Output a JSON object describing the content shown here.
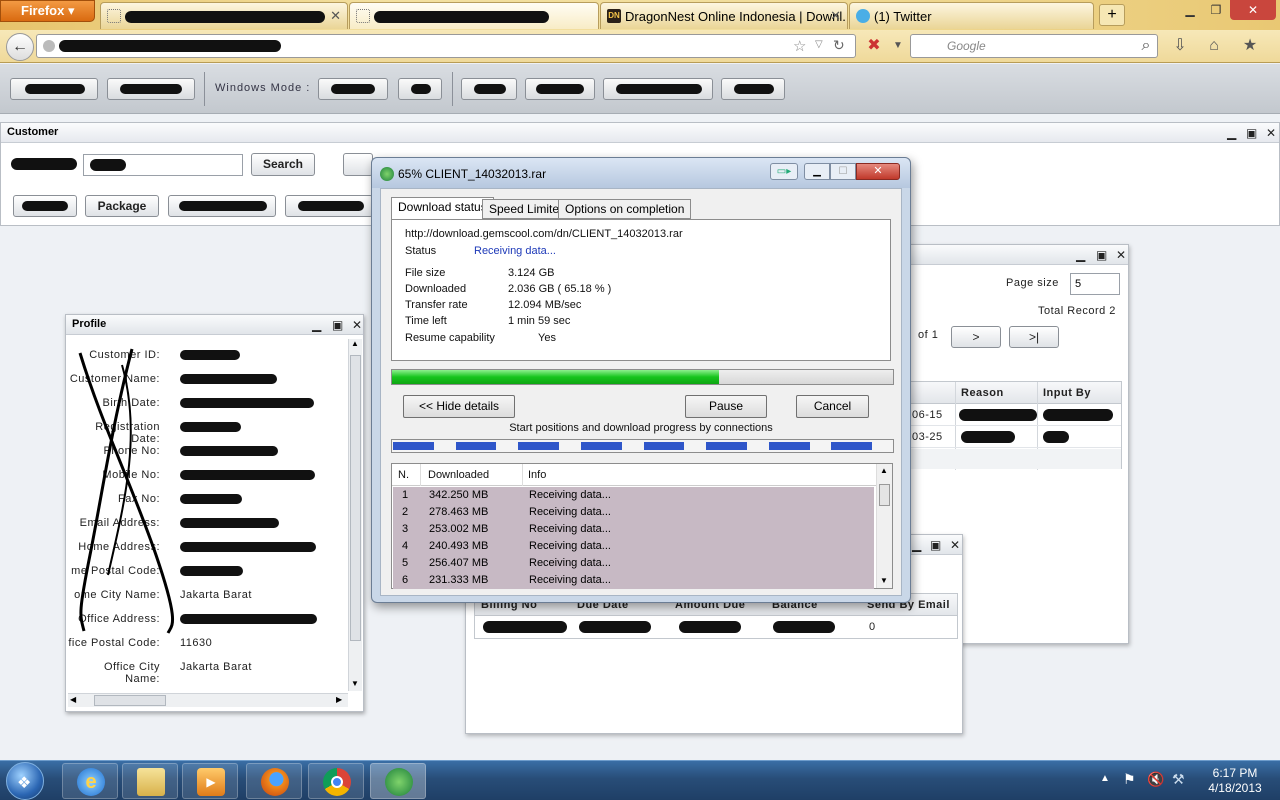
{
  "browser": {
    "menu_label": "Firefox",
    "tabs": [
      {
        "title": ""
      },
      {
        "title": ""
      },
      {
        "title": "DragonNest Online Indonesia | Downl..."
      },
      {
        "title": "(1) Twitter"
      }
    ],
    "search_placeholder": "Google",
    "new_tab": "+"
  },
  "app": {
    "windows_mode_label": "Windows Mode :",
    "customer_panel": {
      "title": "Customer",
      "search_button": "Search",
      "package_button": "Package"
    },
    "profile": {
      "title": "Profile",
      "fields": [
        {
          "label": "Customer ID:",
          "value": ""
        },
        {
          "label": "Customer Name:",
          "value": ""
        },
        {
          "label": "Birth Date:",
          "value": ""
        },
        {
          "label": "Registration Date:",
          "value": ""
        },
        {
          "label": "Phone No:",
          "value": ""
        },
        {
          "label": "Mobile No:",
          "value": ""
        },
        {
          "label": "Fax No:",
          "value": ""
        },
        {
          "label": "Email Address:",
          "value": ""
        },
        {
          "label": "Home Address:",
          "value": ""
        },
        {
          "label": "me Postal Code:",
          "value": ""
        },
        {
          "label": "ome City Name:",
          "value": "Jakarta Barat"
        },
        {
          "label": "Office Address:",
          "value": ""
        },
        {
          "label": "fice Postal Code:",
          "value": "11630"
        },
        {
          "label": "Office City Name:",
          "value": "Jakarta Barat"
        }
      ]
    },
    "history_panel": {
      "page_size_label": "Page size",
      "page_size_value": "5",
      "total_record": "Total Record 2",
      "of_label": "of 1",
      "next_button": ">",
      "last_button": ">|",
      "columns": [
        "Reason",
        "Input By"
      ],
      "rows": [
        [
          "06-15",
          "",
          ""
        ],
        [
          "03-25",
          "",
          ""
        ]
      ]
    },
    "billing_panel": {
      "columns": [
        "Billing No",
        "Due Date",
        "Amount Due",
        "Balance",
        "Send By Email"
      ],
      "rows": [
        [
          "",
          "",
          "",
          "",
          "0"
        ]
      ]
    }
  },
  "download_dialog": {
    "title": "65% CLIENT_14032013.rar",
    "tabs": [
      "Download status",
      "Speed Limiter",
      "Options on completion"
    ],
    "url": "http://download.gemscool.com/dn/CLIENT_14032013.rar",
    "status_label": "Status",
    "status_value": "Receiving data...",
    "file_size_label": "File size",
    "file_size_value": "3.124  GB",
    "downloaded_label": "Downloaded",
    "downloaded_value": "2.036  GB  ( 65.18 % )",
    "transfer_rate_label": "Transfer rate",
    "transfer_rate_value": "12.094  MB/sec",
    "time_left_label": "Time left",
    "time_left_value": "1 min 59 sec",
    "resume_label": "Resume capability",
    "resume_value": "Yes",
    "progress_percent": 65.18,
    "hide_details_button": "<< Hide details",
    "pause_button": "Pause",
    "cancel_button": "Cancel",
    "connections_caption": "Start positions and download progress by connections",
    "list_columns": [
      "N.",
      "Downloaded",
      "Info"
    ],
    "connections": [
      {
        "n": "1",
        "downloaded": "342.250  MB",
        "info": "Receiving data..."
      },
      {
        "n": "2",
        "downloaded": "278.463  MB",
        "info": "Receiving data..."
      },
      {
        "n": "3",
        "downloaded": "253.002  MB",
        "info": "Receiving data..."
      },
      {
        "n": "4",
        "downloaded": "240.493  MB",
        "info": "Receiving data..."
      },
      {
        "n": "5",
        "downloaded": "256.407  MB",
        "info": "Receiving data..."
      },
      {
        "n": "6",
        "downloaded": "231.333  MB",
        "info": "Receiving data..."
      }
    ]
  },
  "taskbar": {
    "time": "6:17 PM",
    "date": "4/18/2013",
    "apps": [
      "internet-explorer",
      "file-explorer",
      "media-player",
      "firefox",
      "chrome",
      "download-manager"
    ]
  }
}
